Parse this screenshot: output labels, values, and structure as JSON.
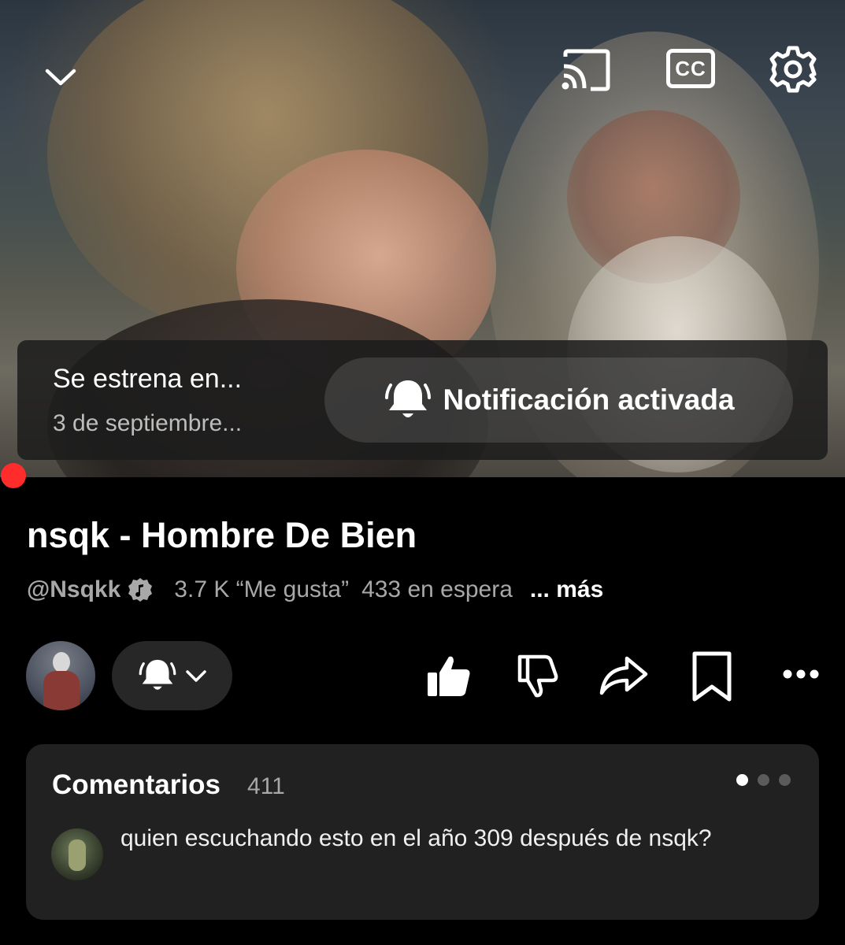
{
  "player": {
    "controls": {
      "collapse_icon": "chevron-down-icon",
      "cast_icon": "cast-icon",
      "captions_icon": "cc-icon",
      "captions_label": "CC",
      "settings_icon": "gear-icon"
    },
    "premiere": {
      "title": "Se estrena en...",
      "date": "3 de septiembre...",
      "notify_icon": "bell-ringing-icon",
      "notify_label": "Notificación activada"
    },
    "progress_color": "#ff2c2c"
  },
  "video": {
    "title": "nsqk - Hombre De Bien",
    "channel": "@Nsqkk",
    "verified_icon": "music-verified-badge-icon",
    "likes": "3.7 K “Me gusta”",
    "waiting": "433 en espera",
    "more_label": "... más"
  },
  "actions": {
    "avatar": "channel-avatar",
    "subscribe_bell_icon": "bell-ringing-icon",
    "subscribe_chevron_icon": "chevron-down-icon",
    "like_icon": "thumbs-up-filled-icon",
    "dislike_icon": "thumbs-down-icon",
    "share_icon": "share-arrow-icon",
    "save_icon": "bookmark-icon",
    "more_icon": "more-horizontal-icon"
  },
  "comments": {
    "title": "Comentarios",
    "count": "411",
    "top_comment": "quien escuchando esto en el año 309 después de nsqk?"
  }
}
